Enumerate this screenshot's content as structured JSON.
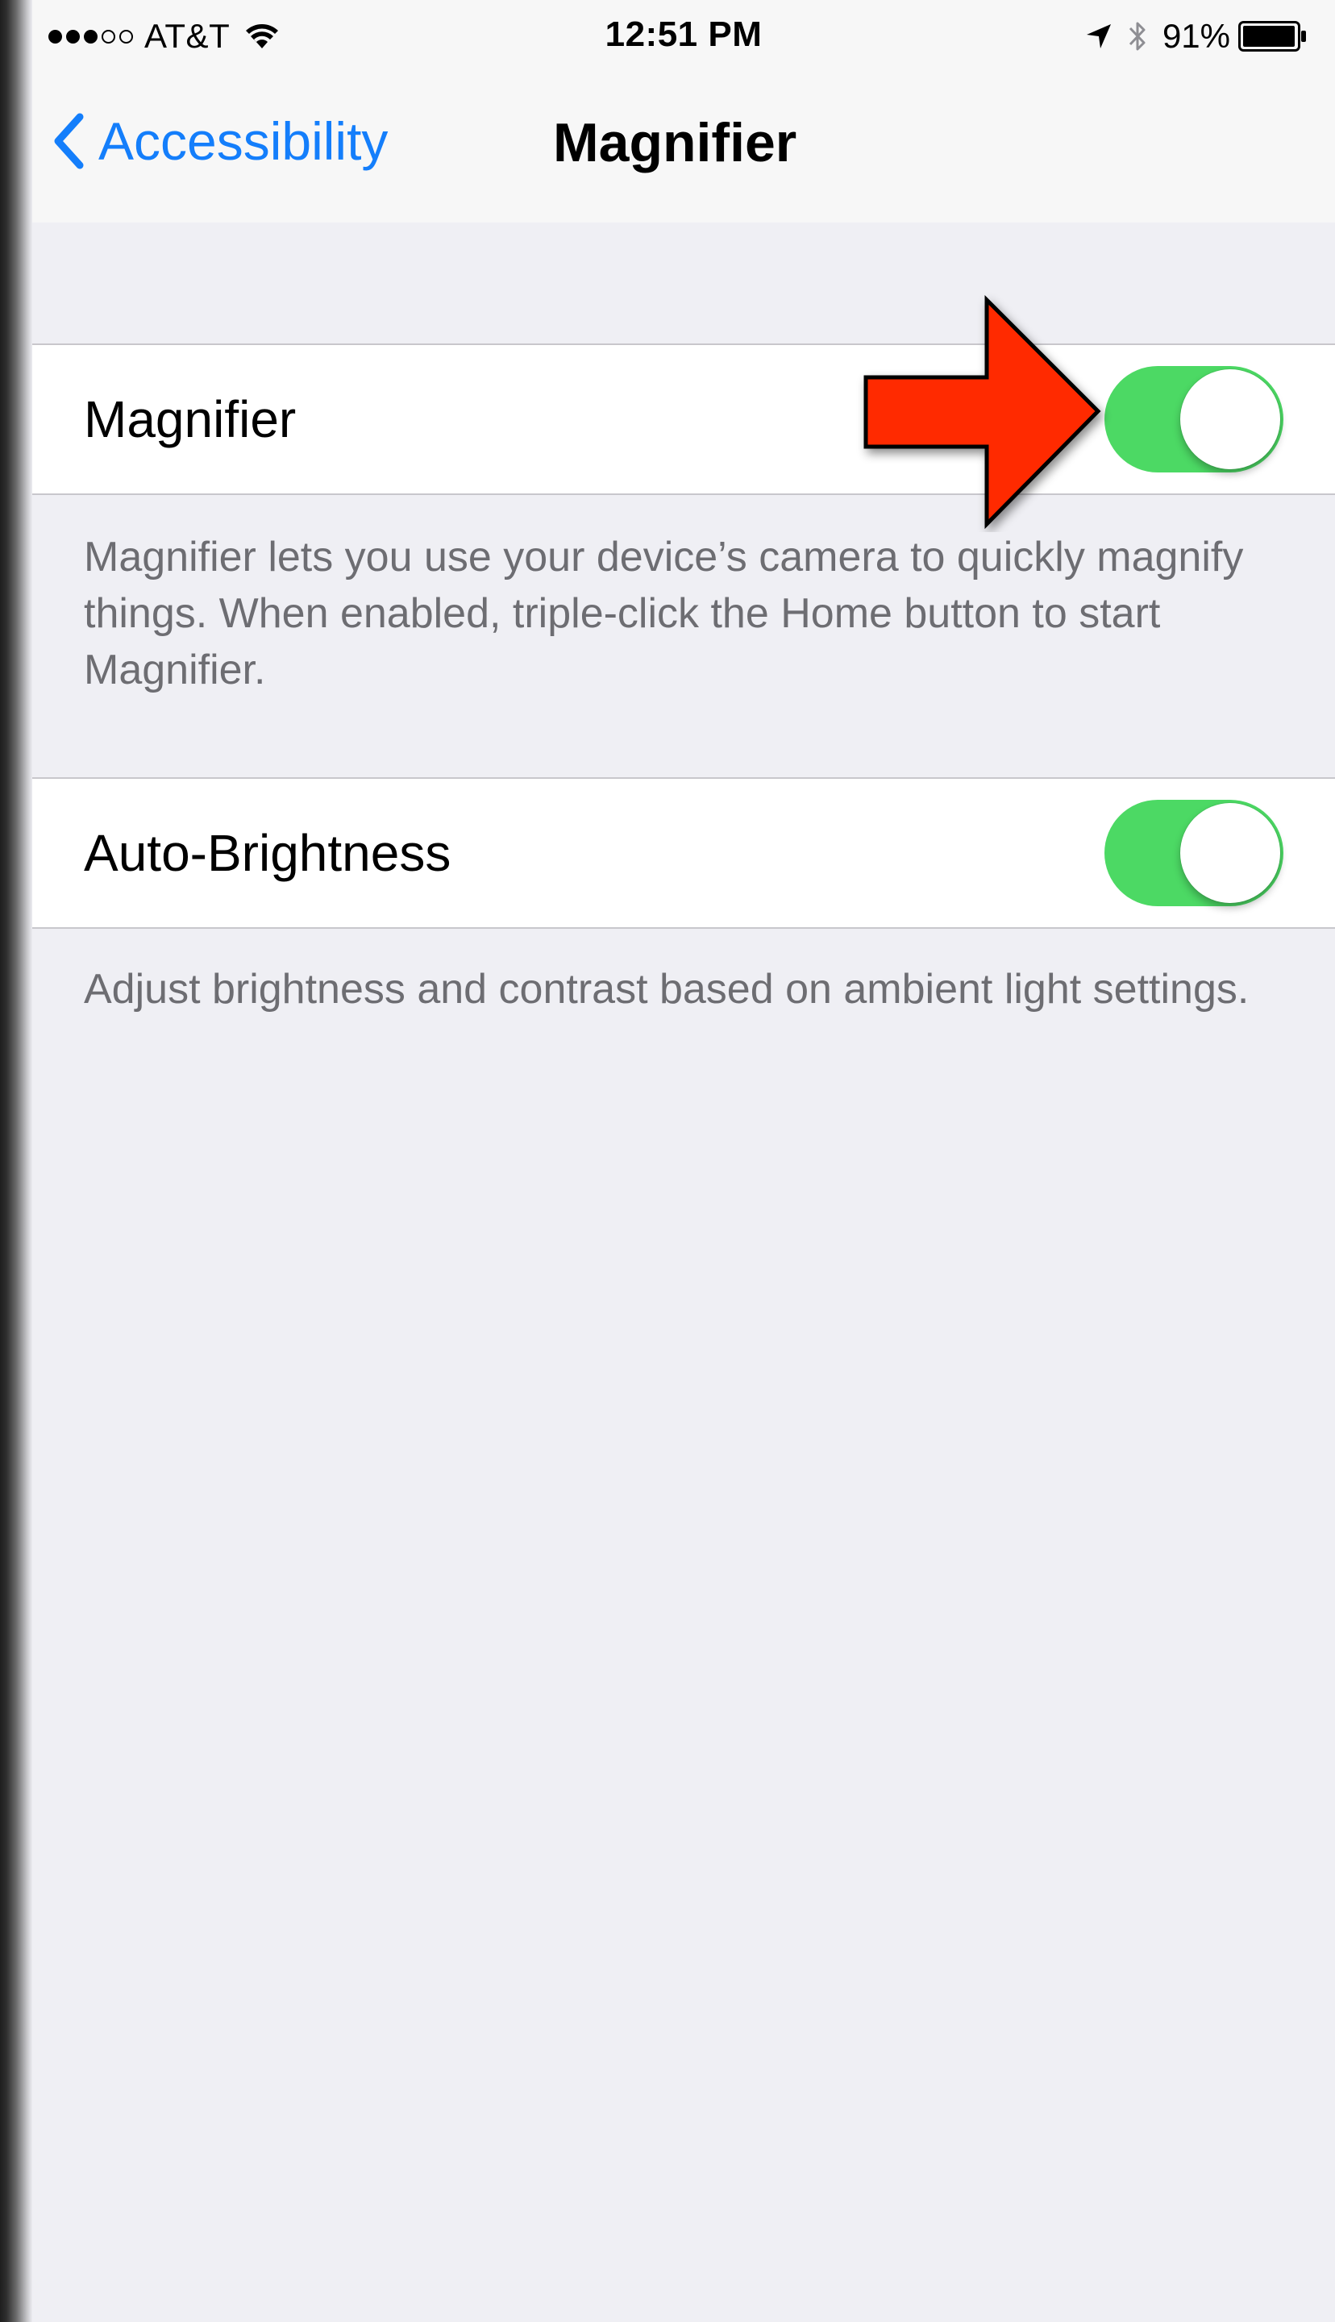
{
  "status_bar": {
    "carrier": "AT&T",
    "signal_bars_filled": 3,
    "signal_bars_total": 5,
    "time": "12:51 PM",
    "battery_percent": "91%",
    "icons": [
      "wifi-icon",
      "location-arrow-icon",
      "bluetooth-icon",
      "battery-icon"
    ]
  },
  "nav": {
    "back_label": "Accessibility",
    "title": "Magnifier"
  },
  "settings": [
    {
      "label": "Magnifier",
      "enabled": true,
      "footer": "Magnifier lets you use your device’s camera to quickly magnify things. When enabled, triple-click the Home button to start Magnifier."
    },
    {
      "label": "Auto-Brightness",
      "enabled": true,
      "footer": "Adjust brightness and contrast based on ambient light settings."
    }
  ],
  "colors": {
    "accent": "#147efb",
    "switch_on": "#4cd964",
    "background": "#efeff4",
    "annotation_arrow": "#ff2a00"
  }
}
